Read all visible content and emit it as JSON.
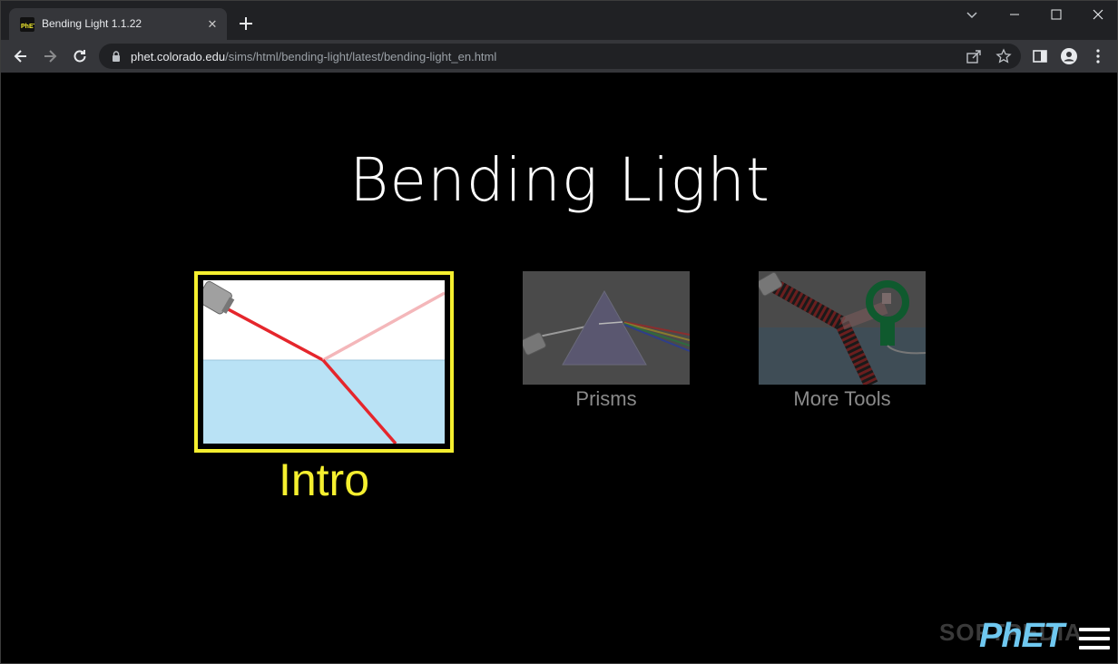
{
  "browser": {
    "tab_title": "Bending Light 1.1.22",
    "close_glyph": "✕",
    "url_host": "phet.colorado.edu",
    "url_path": "/sims/html/bending-light/latest/bending-light_en.html"
  },
  "sim": {
    "title": "Bending Light",
    "screens": [
      {
        "label": "Intro",
        "selected": true
      },
      {
        "label": "Prisms",
        "selected": false
      },
      {
        "label": "More Tools",
        "selected": false
      }
    ],
    "logo": "PhET",
    "watermark": "SOFTPEDIA"
  },
  "colors": {
    "selected": "#f5ef2f",
    "unselected_label": "#8a8a8a",
    "background": "#000000"
  }
}
